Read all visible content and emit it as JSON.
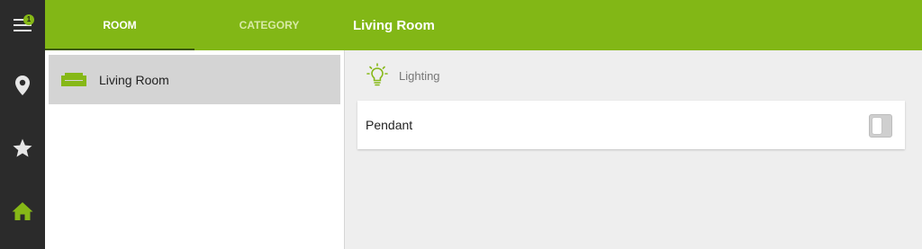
{
  "navigation_rail": {
    "items": [
      {
        "name": "menu",
        "icon": "menu-icon",
        "badge": "1"
      },
      {
        "name": "locations",
        "icon": "map-pin-icon"
      },
      {
        "name": "favorites",
        "icon": "star-icon"
      },
      {
        "name": "home",
        "icon": "home-icon",
        "active": true
      }
    ]
  },
  "header": {
    "tabs": [
      {
        "label": "ROOM",
        "active": true
      },
      {
        "label": "CATEGORY",
        "active": false
      }
    ],
    "title": "Living Room"
  },
  "rooms": {
    "items": [
      {
        "label": "Living Room",
        "icon": "sofa-icon",
        "selected": true
      }
    ]
  },
  "content": {
    "group": {
      "label": "Lighting",
      "icon": "lightbulb-icon"
    },
    "devices": [
      {
        "label": "Pendant",
        "state": "off"
      }
    ]
  },
  "colors": {
    "accent": "#82b716",
    "rail": "#2b2b2b",
    "selected_row": "#d4d4d4",
    "content_bg": "#eeeeee"
  }
}
